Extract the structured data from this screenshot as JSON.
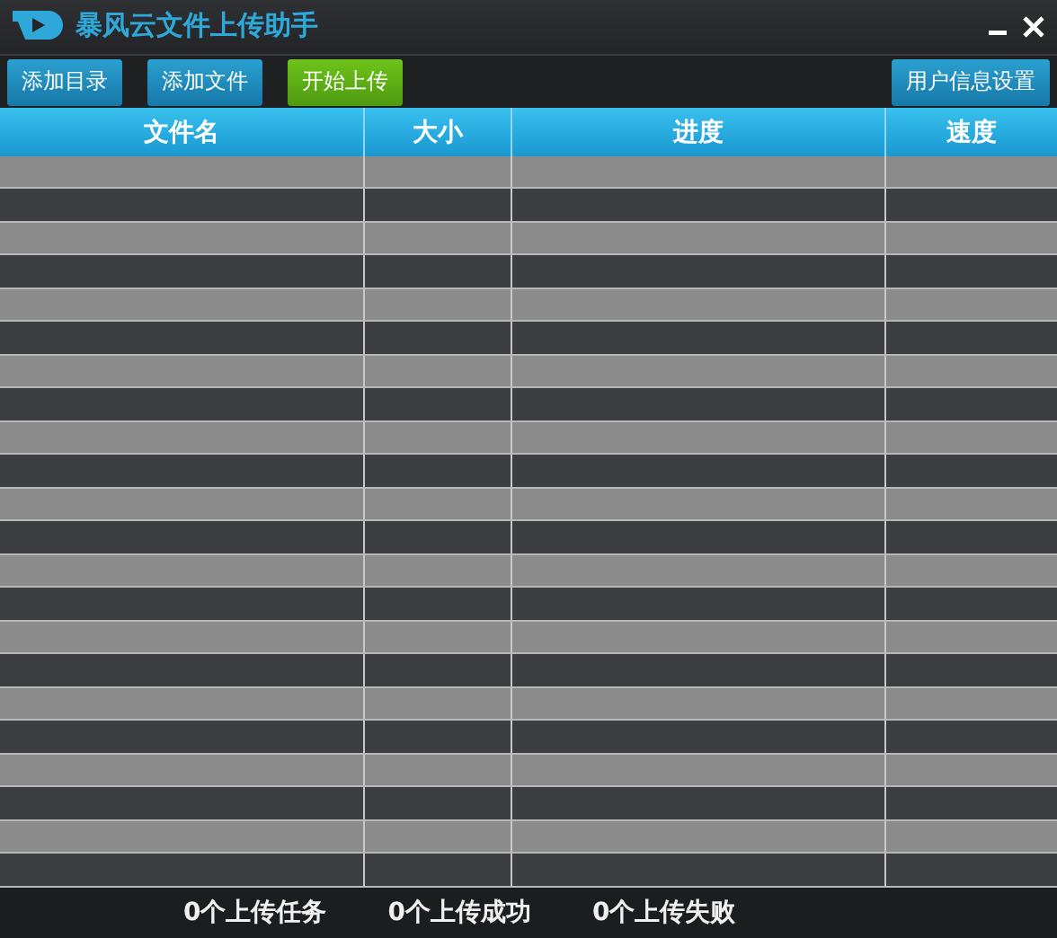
{
  "window": {
    "title": "暴风云文件上传助手"
  },
  "toolbar": {
    "buttons": [
      {
        "label": "添加目录",
        "kind": "normal"
      },
      {
        "label": "添加文件",
        "kind": "normal"
      },
      {
        "label": "开始上传",
        "kind": "primary"
      }
    ],
    "settings_button": {
      "label": "用户信息设置"
    }
  },
  "table": {
    "columns": [
      "文件名",
      "大小",
      "进度",
      "速度"
    ]
  },
  "status_bar": [
    "0个上传任务",
    "0个上传成功",
    "0个上传失败"
  ]
}
